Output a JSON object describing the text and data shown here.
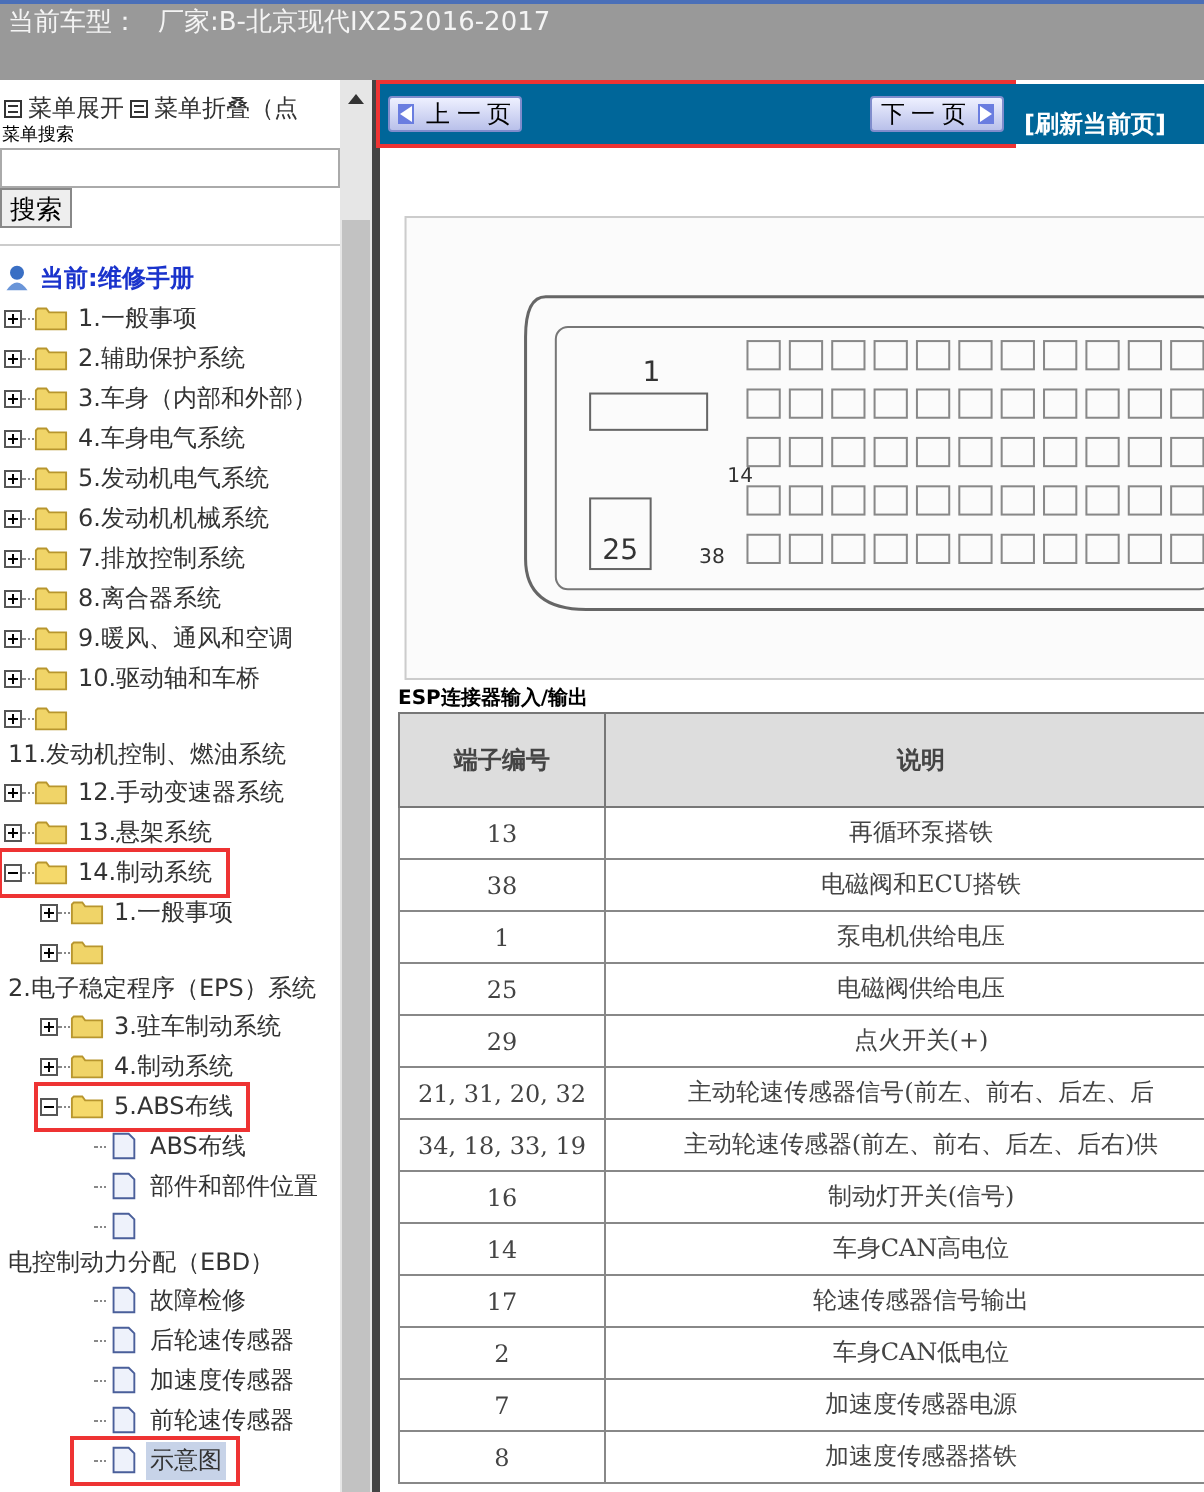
{
  "header": {
    "label": "当前车型：",
    "value": "厂家:B-北京现代IX252016-2017"
  },
  "menu": {
    "expand": "菜单展开",
    "collapse": "菜单折叠（点",
    "search_label": "菜单搜索",
    "search_button": "搜索"
  },
  "tree": {
    "root": "当前:维修手册",
    "items": [
      {
        "label": "1.一般事项",
        "kind": "folder",
        "expanded": false,
        "highlighted": false,
        "selected": false,
        "wrapped": false
      },
      {
        "label": "2.辅助保护系统",
        "kind": "folder",
        "expanded": false,
        "highlighted": false,
        "selected": false,
        "wrapped": false
      },
      {
        "label": "3.车身（内部和外部）",
        "kind": "folder",
        "expanded": false,
        "highlighted": false,
        "selected": false,
        "wrapped": false
      },
      {
        "label": "4.车身电气系统",
        "kind": "folder",
        "expanded": false,
        "highlighted": false,
        "selected": false,
        "wrapped": false
      },
      {
        "label": "5.发动机电气系统",
        "kind": "folder",
        "expanded": false,
        "highlighted": false,
        "selected": false,
        "wrapped": false
      },
      {
        "label": "6.发动机机械系统",
        "kind": "folder",
        "expanded": false,
        "highlighted": false,
        "selected": false,
        "wrapped": false
      },
      {
        "label": "7.排放控制系统",
        "kind": "folder",
        "expanded": false,
        "highlighted": false,
        "selected": false,
        "wrapped": false
      },
      {
        "label": "8.离合器系统",
        "kind": "folder",
        "expanded": false,
        "highlighted": false,
        "selected": false,
        "wrapped": false
      },
      {
        "label": "9.暖风、通风和空调",
        "kind": "folder",
        "expanded": false,
        "highlighted": false,
        "selected": false,
        "wrapped": false
      },
      {
        "label": "10.驱动轴和车桥",
        "kind": "folder",
        "expanded": false,
        "highlighted": false,
        "selected": false,
        "wrapped": false
      },
      {
        "label": "11.发动机控制、燃油系统",
        "kind": "folder",
        "expanded": false,
        "highlighted": false,
        "selected": false,
        "wrapped": true
      },
      {
        "label": "12.手动变速器系统",
        "kind": "folder",
        "expanded": false,
        "highlighted": false,
        "selected": false,
        "wrapped": false
      },
      {
        "label": "13.悬架系统",
        "kind": "folder",
        "expanded": false,
        "highlighted": false,
        "selected": false,
        "wrapped": false
      },
      {
        "label": "14.制动系统",
        "kind": "folder",
        "expanded": true,
        "highlighted": true,
        "selected": false,
        "wrapped": false,
        "children": [
          {
            "label": "1.一般事项",
            "kind": "folder",
            "expanded": false,
            "highlighted": false,
            "selected": false,
            "wrapped": false
          },
          {
            "label": "2.电子稳定程序（EPS）系统",
            "kind": "folder",
            "expanded": false,
            "highlighted": false,
            "selected": false,
            "wrapped": true
          },
          {
            "label": "3.驻车制动系统",
            "kind": "folder",
            "expanded": false,
            "highlighted": false,
            "selected": false,
            "wrapped": false
          },
          {
            "label": "4.制动系统",
            "kind": "folder",
            "expanded": false,
            "highlighted": false,
            "selected": false,
            "wrapped": false
          },
          {
            "label": "5.ABS布线",
            "kind": "folder",
            "expanded": true,
            "highlighted": true,
            "selected": false,
            "wrapped": false,
            "children": [
              {
                "label": "ABS布线",
                "kind": "page",
                "highlighted": false,
                "selected": false,
                "wrapped": false
              },
              {
                "label": "部件和部件位置",
                "kind": "page",
                "highlighted": false,
                "selected": false,
                "wrapped": false
              },
              {
                "label": "电控制动力分配（EBD）",
                "kind": "page",
                "highlighted": false,
                "selected": false,
                "wrapped": true
              },
              {
                "label": "故障检修",
                "kind": "page",
                "highlighted": false,
                "selected": false,
                "wrapped": false
              },
              {
                "label": "后轮速传感器",
                "kind": "page",
                "highlighted": false,
                "selected": false,
                "wrapped": false
              },
              {
                "label": "加速度传感器",
                "kind": "page",
                "highlighted": false,
                "selected": false,
                "wrapped": false
              },
              {
                "label": "前轮速传感器",
                "kind": "page",
                "highlighted": false,
                "selected": false,
                "wrapped": false
              },
              {
                "label": "示意图",
                "kind": "page",
                "highlighted": true,
                "selected": true,
                "wrapped": false
              }
            ]
          }
        ]
      }
    ]
  },
  "nav": {
    "prev": "上 一 页",
    "next": "下 一 页",
    "refresh": "[刷新当前页]",
    "highlighted": true
  },
  "document": {
    "pins": [
      "1",
      "14",
      "25",
      "38"
    ],
    "caption": "ESP连接器输入/输出",
    "table": {
      "columns": [
        "端子编号",
        "说明"
      ],
      "rows": [
        [
          "13",
          "再循环泵搭铁"
        ],
        [
          "38",
          "电磁阀和ECU搭铁"
        ],
        [
          "1",
          "泵电机供给电压"
        ],
        [
          "25",
          "电磁阀供给电压"
        ],
        [
          "29",
          "点火开关(+)"
        ],
        [
          "21, 31, 20, 32",
          "主动轮速传感器信号(前左、前右、后左、后"
        ],
        [
          "34, 18, 33, 19",
          "主动轮速传感器(前左、前右、后左、后右)供"
        ],
        [
          "16",
          "制动灯开关(信号)"
        ],
        [
          "14",
          "车身CAN高电位"
        ],
        [
          "17",
          "轮速传感器信号输出"
        ],
        [
          "2",
          "车身CAN低电位"
        ],
        [
          "7",
          "加速度传感器电源"
        ],
        [
          "8",
          "加速度传感器搭铁"
        ]
      ]
    }
  }
}
